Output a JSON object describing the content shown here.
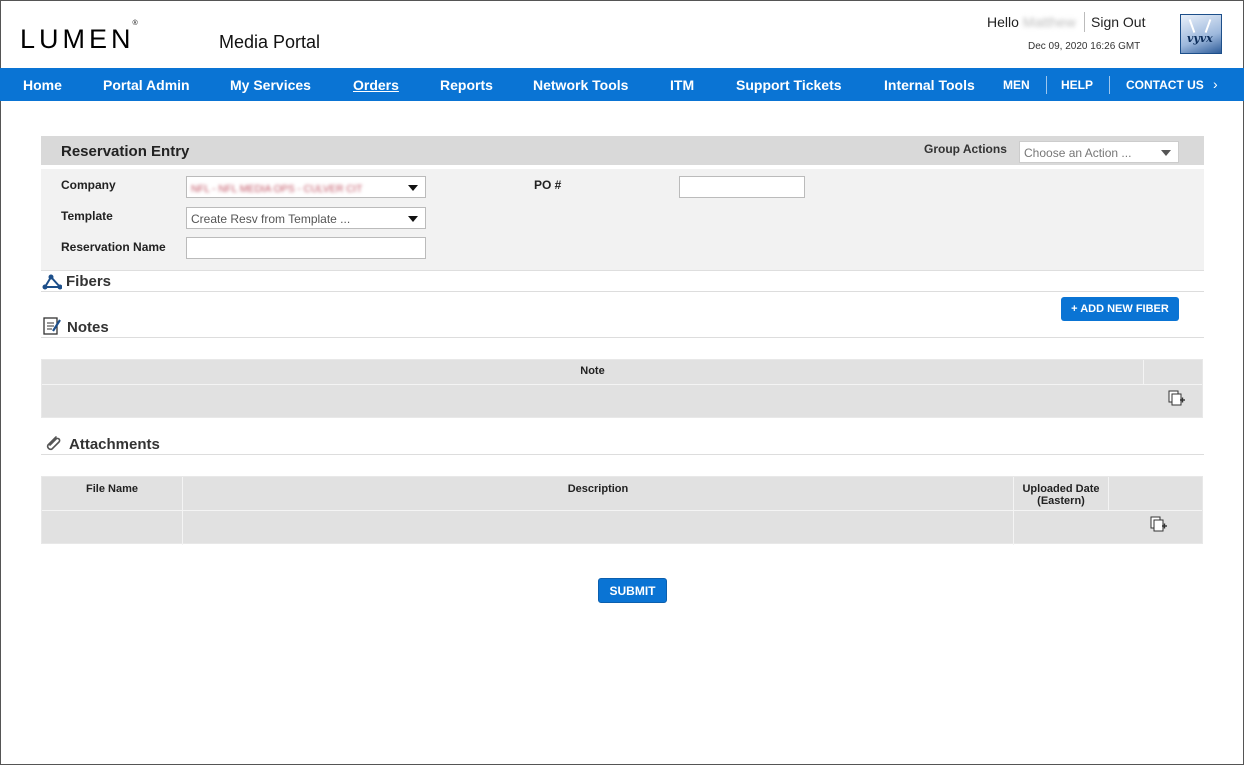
{
  "header": {
    "logo_text": "LUMEN",
    "logo_mark": "®",
    "portal_title": "Media Portal",
    "hello_prefix": "Hello",
    "user_name_redacted": "Matthew",
    "signout_label": "Sign Out",
    "datetime": "Dec 09, 2020 16:26 GMT",
    "partner_logo_text": "vyvx"
  },
  "nav": {
    "items": [
      {
        "label": "Home"
      },
      {
        "label": "Portal Admin"
      },
      {
        "label": "My Services"
      },
      {
        "label": "Orders",
        "active": true
      },
      {
        "label": "Reports"
      },
      {
        "label": "Network Tools"
      },
      {
        "label": "ITM"
      },
      {
        "label": "Support Tickets"
      },
      {
        "label": "Internal Tools"
      }
    ],
    "right_items": [
      {
        "label": "MEN"
      },
      {
        "label": "HELP"
      },
      {
        "label": "CONTACT US"
      }
    ],
    "accent": "#0a74d4"
  },
  "reservation": {
    "title": "Reservation Entry",
    "group_actions_label": "Group Actions",
    "group_actions_placeholder": "Choose an Action ...",
    "company_label": "Company",
    "company_value": "NFL - NFL MEDIA OPS - CULVER CIT",
    "template_label": "Template",
    "template_value": "Create Resv from Template ...",
    "reservation_name_label": "Reservation Name",
    "reservation_name_value": "",
    "po_label": "PO #",
    "po_value": ""
  },
  "fibers": {
    "title": "Fibers",
    "add_button": "+ ADD NEW FIBER"
  },
  "notes": {
    "title": "Notes",
    "columns": [
      "Note"
    ]
  },
  "attachments": {
    "title": "Attachments",
    "columns": [
      "File Name",
      "Description",
      "Uploaded Date",
      "(Eastern)"
    ]
  },
  "submit_label": "SUBMIT"
}
